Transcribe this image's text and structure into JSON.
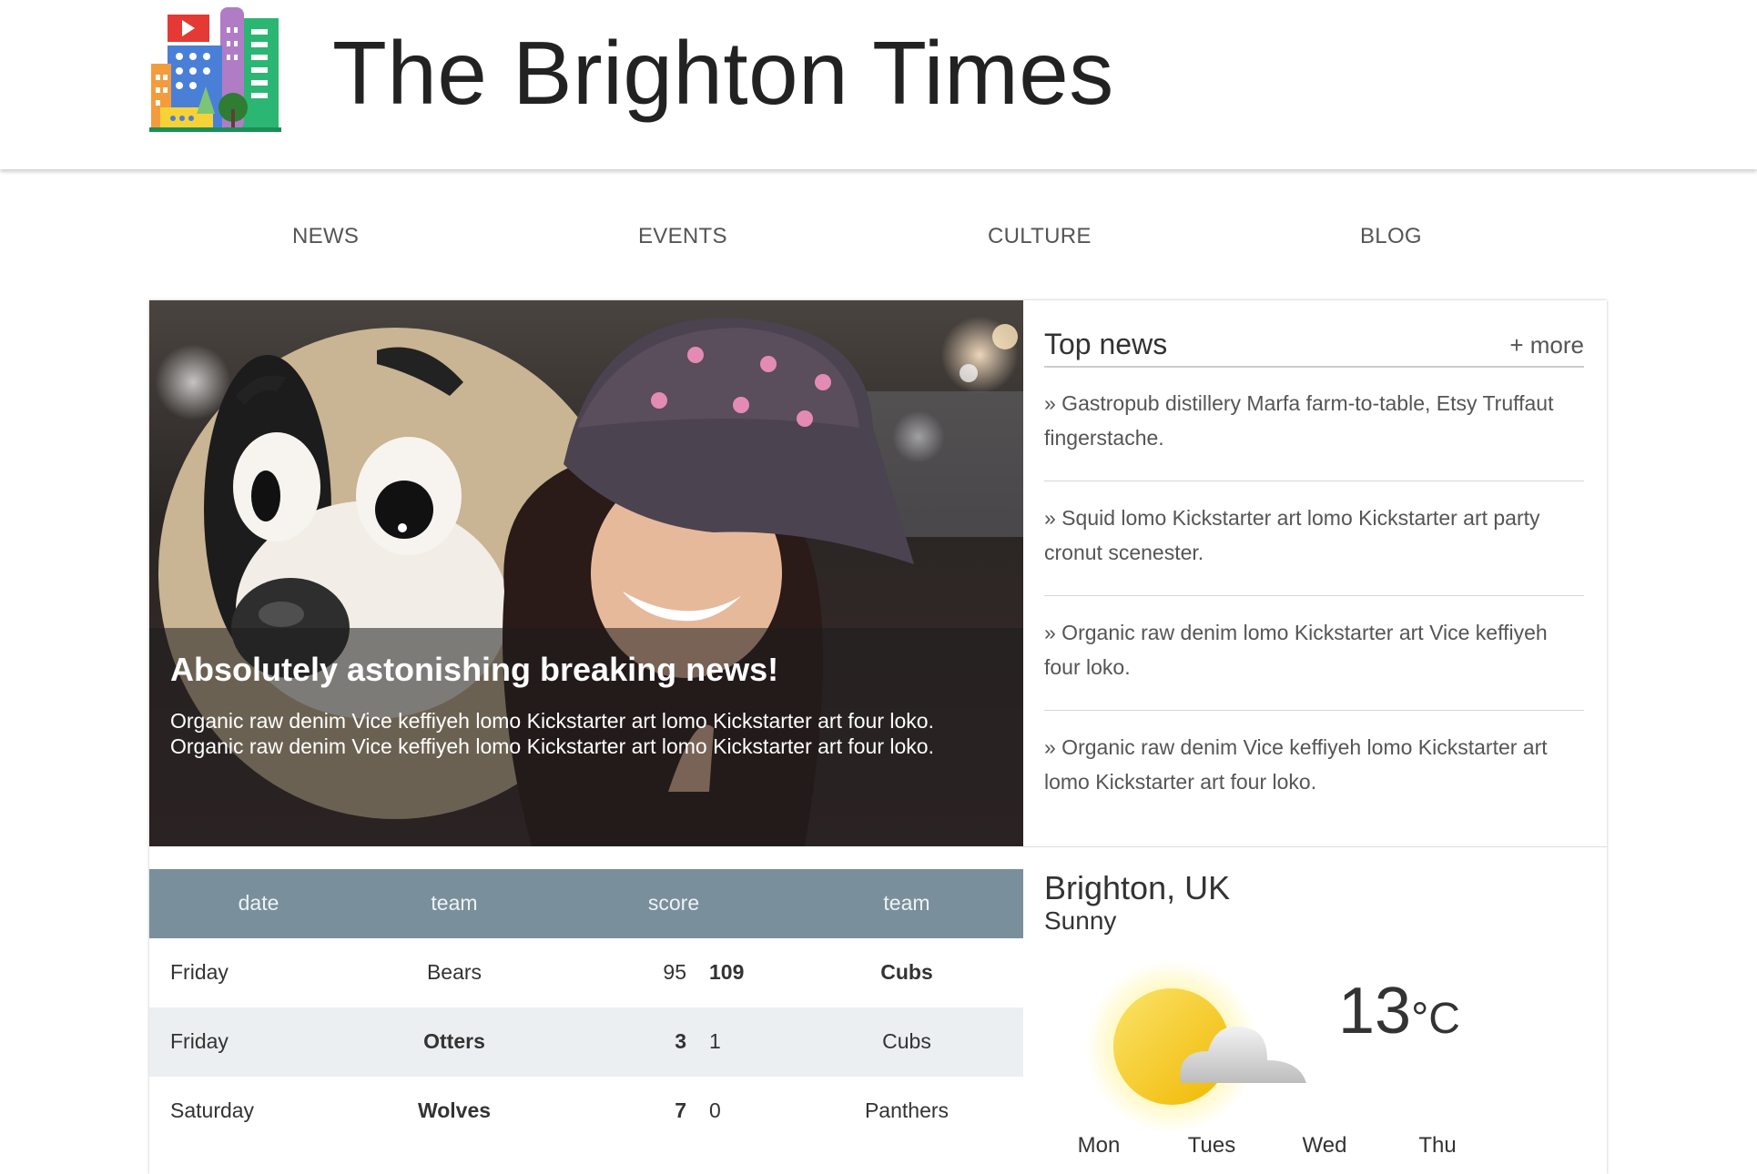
{
  "site": {
    "title": "The Brighton Times"
  },
  "nav": [
    "NEWS",
    "EVENTS",
    "CULTURE",
    "BLOG"
  ],
  "hero": {
    "title": "Absolutely astonishing breaking news!",
    "text": "Organic raw denim Vice keffiyeh lomo Kickstarter art lomo Kickstarter art four loko. Organic raw denim Vice keffiyeh lomo Kickstarter art lomo Kickstarter art four loko."
  },
  "top_news": {
    "title": "Top news",
    "more": "+ more",
    "items": [
      "» Gastropub distillery Marfa farm-to-table, Etsy Truffaut fingerstache.",
      "» Squid lomo Kickstarter art lomo Kickstarter art party cronut scenester.",
      "» Organic raw denim lomo Kickstarter art Vice keffiyeh four loko.",
      "» Organic raw denim Vice keffiyeh lomo Kickstarter art lomo Kickstarter art four loko."
    ]
  },
  "scores": {
    "headers": [
      "date",
      "team",
      "score",
      "team"
    ],
    "rows": [
      {
        "date": "Friday",
        "team1": "Bears",
        "score1": "95",
        "score2": "109",
        "team2": "Cubs",
        "winner": 2
      },
      {
        "date": "Friday",
        "team1": "Otters",
        "score1": "3",
        "score2": "1",
        "team2": "Cubs",
        "winner": 1
      },
      {
        "date": "Saturday",
        "team1": "Wolves",
        "score1": "7",
        "score2": "0",
        "team2": "Panthers",
        "winner": 1
      }
    ]
  },
  "weather": {
    "city": "Brighton, UK",
    "condition": "Sunny",
    "temp": "13",
    "unit": "°C",
    "days": [
      "Mon",
      "Tues",
      "Wed",
      "Thu"
    ],
    "icon": "sun-behind-cloud-icon"
  },
  "colors": {
    "table_header": "#7a8f9c",
    "row_alt": "#eceff1",
    "accent_sun": "#f5c518"
  }
}
